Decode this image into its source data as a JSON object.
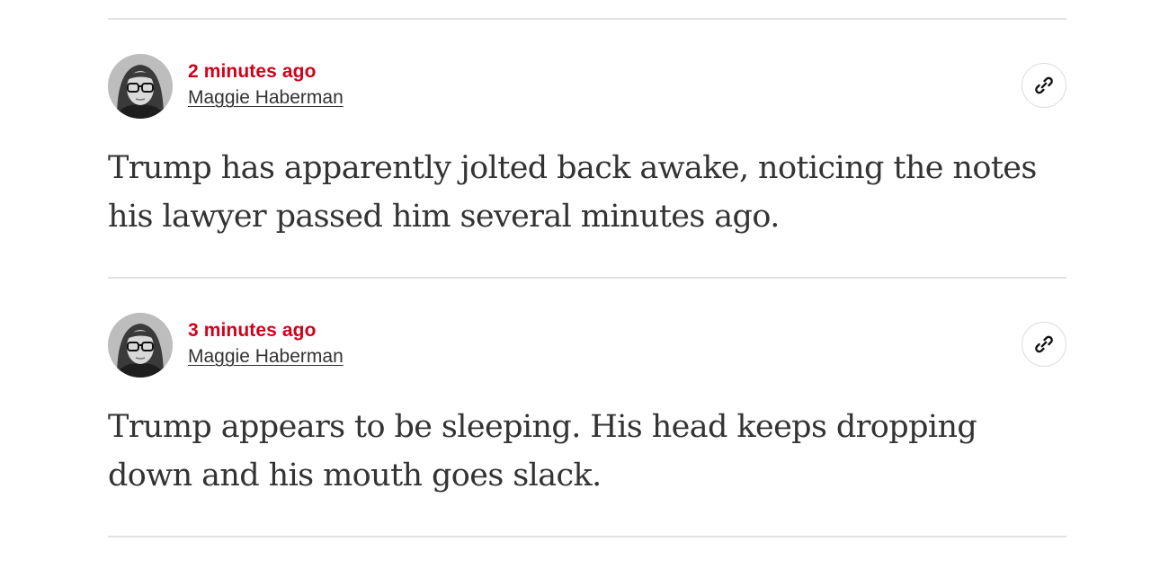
{
  "entries": [
    {
      "timestamp": "2 minutes ago",
      "author": "Maggie Haberman",
      "text": "Trump has apparently jolted back awake, noticing the notes his lawyer passed him several minutes ago.",
      "link_icon": "link-icon"
    },
    {
      "timestamp": "3 minutes ago",
      "author": "Maggie Haberman",
      "text": "Trump appears to be sleeping. His head keeps dropping down and his mouth goes slack.",
      "link_icon": "link-icon"
    }
  ],
  "colors": {
    "timestamp": "#d0021b",
    "text": "#333333",
    "divider": "#e2e2e2"
  }
}
